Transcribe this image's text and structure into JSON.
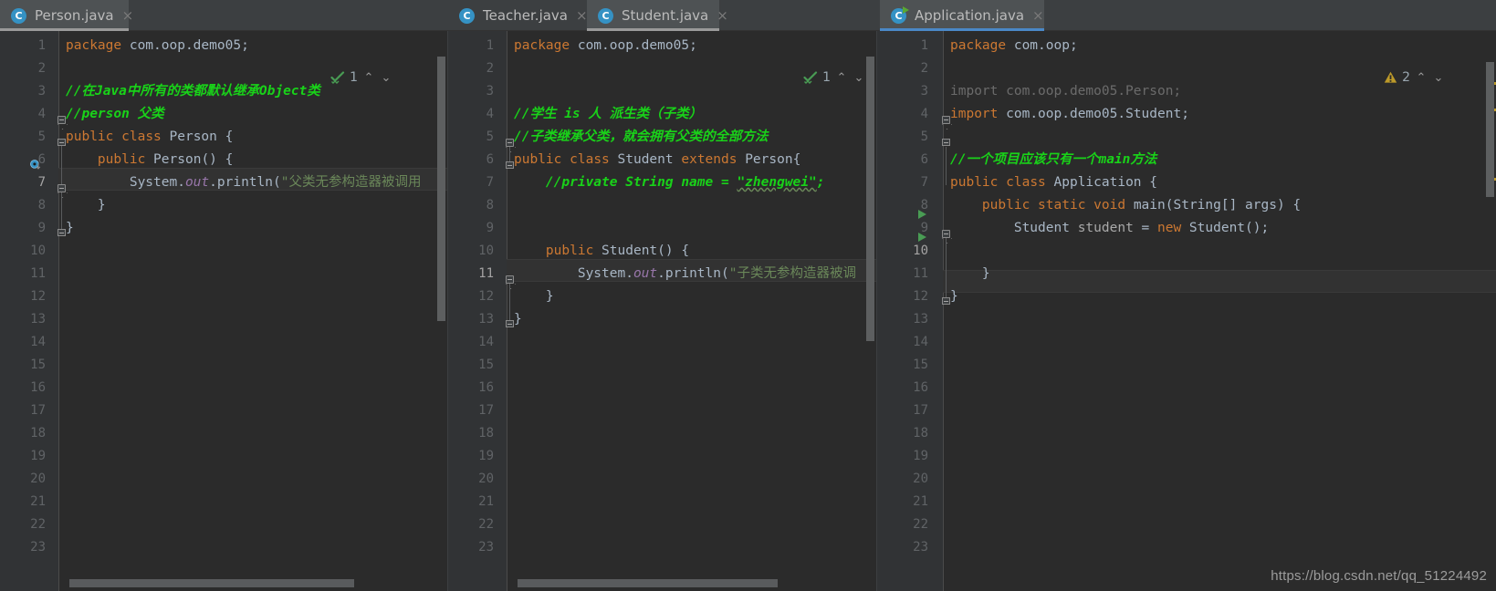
{
  "window": {
    "theme": "darcula",
    "bg": "#3c3f41",
    "editor_bg": "#2b2b2b",
    "gutter_bg": "#313335",
    "accent": "#4a88c7",
    "comment_color": "#19d219",
    "keyword_color": "#cc7832",
    "string_color": "#6a8759",
    "warning_color": "#bd9a29",
    "ok_color": "#499c54"
  },
  "watermark": "https://blog.csdn.net/qq_51224492",
  "tabs": [
    {
      "label": "Person.java",
      "icon": "java-class-icon",
      "close": "×",
      "state": "selected"
    },
    {
      "label": "Teacher.java",
      "icon": "java-class-icon",
      "close": "×",
      "state": "inactive"
    },
    {
      "label": "Student.java",
      "icon": "java-class-icon",
      "close": "×",
      "state": "selected"
    },
    {
      "label": "Application.java",
      "icon": "java-runnable-class-icon",
      "close": "×",
      "state": "focused"
    }
  ],
  "panes": [
    {
      "name": "person-editor",
      "file": "Person.java",
      "current_line": 7,
      "line_count": 23,
      "inspection": {
        "icon": "ok-check-icon",
        "count": "1",
        "up": "⌃",
        "down": "⌄"
      },
      "lines": [
        {
          "n": 1,
          "tokens": [
            {
              "t": "package",
              "c": "kw"
            },
            {
              "t": " ",
              "c": "id"
            },
            {
              "t": "com.oop.demo05",
              "c": "pkg"
            },
            {
              "t": ";",
              "c": "id"
            }
          ]
        },
        {
          "n": 2,
          "tokens": []
        },
        {
          "n": 3,
          "tokens": [
            {
              "t": "//在Java中所有的类都默认继承Object类",
              "c": "cmt"
            }
          ]
        },
        {
          "n": 4,
          "tokens": [
            {
              "t": "//person 父类",
              "c": "cmt"
            }
          ]
        },
        {
          "n": 5,
          "tokens": [
            {
              "t": "public",
              "c": "kw"
            },
            {
              "t": " ",
              "c": "id"
            },
            {
              "t": "class",
              "c": "kw"
            },
            {
              "t": " Person {",
              "c": "cls"
            }
          ]
        },
        {
          "n": 6,
          "tokens": [
            {
              "t": "    ",
              "c": "id"
            },
            {
              "t": "public",
              "c": "kw"
            },
            {
              "t": " ",
              "c": "id"
            },
            {
              "t": "Person",
              "c": "cls"
            },
            {
              "t": "() {",
              "c": "id"
            }
          ]
        },
        {
          "n": 7,
          "tokens": [
            {
              "t": "        System.",
              "c": "id"
            },
            {
              "t": "out",
              "c": "fld"
            },
            {
              "t": ".println(",
              "c": "id"
            },
            {
              "t": "\"父类无参构造器被调用",
              "c": "str"
            }
          ]
        },
        {
          "n": 8,
          "tokens": [
            {
              "t": "    }",
              "c": "id"
            }
          ]
        },
        {
          "n": 9,
          "tokens": [
            {
              "t": "}",
              "c": "id"
            }
          ]
        },
        {
          "n": 10,
          "tokens": []
        },
        {
          "n": 11,
          "tokens": []
        },
        {
          "n": 12,
          "tokens": []
        },
        {
          "n": 13,
          "tokens": []
        },
        {
          "n": 14,
          "tokens": []
        },
        {
          "n": 15,
          "tokens": []
        },
        {
          "n": 16,
          "tokens": []
        },
        {
          "n": 17,
          "tokens": []
        },
        {
          "n": 18,
          "tokens": []
        },
        {
          "n": 19,
          "tokens": []
        },
        {
          "n": 20,
          "tokens": []
        },
        {
          "n": 21,
          "tokens": []
        },
        {
          "n": 22,
          "tokens": []
        },
        {
          "n": 23,
          "tokens": []
        }
      ]
    },
    {
      "name": "student-editor",
      "file": "Student.java",
      "current_line": 11,
      "line_count": 23,
      "inspection": {
        "icon": "ok-check-icon",
        "count": "1",
        "up": "⌃",
        "down": "⌄"
      },
      "lines": [
        {
          "n": 1,
          "tokens": [
            {
              "t": "package",
              "c": "kw"
            },
            {
              "t": " ",
              "c": "id"
            },
            {
              "t": "com.oop.demo05",
              "c": "pkg"
            },
            {
              "t": ";",
              "c": "id"
            }
          ]
        },
        {
          "n": 2,
          "tokens": []
        },
        {
          "n": 3,
          "tokens": []
        },
        {
          "n": 4,
          "tokens": [
            {
              "t": "//学生 is 人 派生类（子类）",
              "c": "cmt"
            }
          ]
        },
        {
          "n": 5,
          "tokens": [
            {
              "t": "//子类继承父类，就会拥有父类的全部方法",
              "c": "cmt"
            }
          ]
        },
        {
          "n": 6,
          "tokens": [
            {
              "t": "public",
              "c": "kw"
            },
            {
              "t": " ",
              "c": "id"
            },
            {
              "t": "class",
              "c": "kw"
            },
            {
              "t": " Student ",
              "c": "cls"
            },
            {
              "t": "extends",
              "c": "kw"
            },
            {
              "t": " Person{",
              "c": "cls"
            }
          ]
        },
        {
          "n": 7,
          "tokens": [
            {
              "t": "    //private String name = ",
              "c": "cmt"
            },
            {
              "t": "\"zhengwei\"",
              "c": "cmt typo"
            },
            {
              "t": ";",
              "c": "cmt"
            }
          ]
        },
        {
          "n": 8,
          "tokens": []
        },
        {
          "n": 9,
          "tokens": []
        },
        {
          "n": 10,
          "tokens": [
            {
              "t": "    ",
              "c": "id"
            },
            {
              "t": "public",
              "c": "kw"
            },
            {
              "t": " ",
              "c": "id"
            },
            {
              "t": "Student",
              "c": "cls"
            },
            {
              "t": "() {",
              "c": "id"
            }
          ]
        },
        {
          "n": 11,
          "tokens": [
            {
              "t": "        System.",
              "c": "id"
            },
            {
              "t": "out",
              "c": "fld"
            },
            {
              "t": ".println(",
              "c": "id"
            },
            {
              "t": "\"子类无参构造器被调",
              "c": "str"
            }
          ]
        },
        {
          "n": 12,
          "tokens": [
            {
              "t": "    }",
              "c": "id"
            }
          ]
        },
        {
          "n": 13,
          "tokens": [
            {
              "t": "}",
              "c": "id"
            }
          ]
        },
        {
          "n": 14,
          "tokens": []
        },
        {
          "n": 15,
          "tokens": []
        },
        {
          "n": 16,
          "tokens": []
        },
        {
          "n": 17,
          "tokens": []
        },
        {
          "n": 18,
          "tokens": []
        },
        {
          "n": 19,
          "tokens": []
        },
        {
          "n": 20,
          "tokens": []
        },
        {
          "n": 21,
          "tokens": []
        },
        {
          "n": 22,
          "tokens": []
        },
        {
          "n": 23,
          "tokens": []
        }
      ]
    },
    {
      "name": "application-editor",
      "file": "Application.java",
      "current_line": 10,
      "line_count": 23,
      "inspection": {
        "icon": "warning-triangle-icon",
        "count": "2",
        "up": "⌃",
        "down": "⌄"
      },
      "lines": [
        {
          "n": 1,
          "tokens": [
            {
              "t": "package",
              "c": "kw"
            },
            {
              "t": " ",
              "c": "id"
            },
            {
              "t": "com.oop",
              "c": "pkg"
            },
            {
              "t": ";",
              "c": "id"
            }
          ]
        },
        {
          "n": 2,
          "tokens": []
        },
        {
          "n": 3,
          "tokens": [
            {
              "t": "import com.oop.demo05.Person;",
              "c": "dim"
            }
          ]
        },
        {
          "n": 4,
          "tokens": [
            {
              "t": "import",
              "c": "kw"
            },
            {
              "t": " ",
              "c": "id"
            },
            {
              "t": "com.oop.demo05.Student",
              "c": "pkg"
            },
            {
              "t": ";",
              "c": "id"
            }
          ]
        },
        {
          "n": 5,
          "tokens": []
        },
        {
          "n": 6,
          "tokens": [
            {
              "t": "//一个项目应该只有一个main方法",
              "c": "cmt"
            }
          ]
        },
        {
          "n": 7,
          "tokens": [
            {
              "t": "public",
              "c": "kw"
            },
            {
              "t": " ",
              "c": "id"
            },
            {
              "t": "class",
              "c": "kw"
            },
            {
              "t": " Application {",
              "c": "cls"
            }
          ]
        },
        {
          "n": 8,
          "tokens": [
            {
              "t": "    ",
              "c": "id"
            },
            {
              "t": "public",
              "c": "kw"
            },
            {
              "t": " ",
              "c": "id"
            },
            {
              "t": "static",
              "c": "kw"
            },
            {
              "t": " ",
              "c": "id"
            },
            {
              "t": "void",
              "c": "kw"
            },
            {
              "t": " ",
              "c": "id"
            },
            {
              "t": "main",
              "c": "cls"
            },
            {
              "t": "(String[] args) {",
              "c": "id"
            }
          ]
        },
        {
          "n": 9,
          "tokens": [
            {
              "t": "        Student ",
              "c": "id"
            },
            {
              "t": "student",
              "c": "lv"
            },
            {
              "t": " = ",
              "c": "id"
            },
            {
              "t": "new",
              "c": "kw"
            },
            {
              "t": " Student();",
              "c": "id"
            }
          ]
        },
        {
          "n": 10,
          "tokens": []
        },
        {
          "n": 11,
          "tokens": [
            {
              "t": "    }",
              "c": "id"
            }
          ]
        },
        {
          "n": 12,
          "tokens": [
            {
              "t": "}",
              "c": "id"
            }
          ]
        },
        {
          "n": 13,
          "tokens": []
        },
        {
          "n": 14,
          "tokens": []
        },
        {
          "n": 15,
          "tokens": []
        },
        {
          "n": 16,
          "tokens": []
        },
        {
          "n": 17,
          "tokens": []
        },
        {
          "n": 18,
          "tokens": []
        },
        {
          "n": 19,
          "tokens": []
        },
        {
          "n": 20,
          "tokens": []
        },
        {
          "n": 21,
          "tokens": []
        },
        {
          "n": 22,
          "tokens": []
        },
        {
          "n": 23,
          "tokens": []
        }
      ]
    }
  ]
}
